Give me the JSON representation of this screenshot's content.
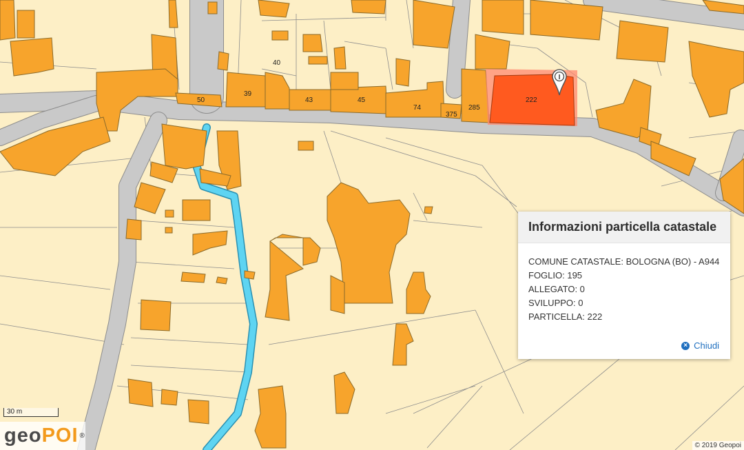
{
  "map": {
    "parcel_labels": [
      "40",
      "50",
      "39",
      "43",
      "45",
      "74",
      "375",
      "285",
      "222"
    ],
    "selected_parcel": "222",
    "marker_glyph": "I",
    "colors": {
      "background": "#fdefc6",
      "building": "#f7a42c",
      "selected": "#ff5a1f",
      "road": "#c9c9c9",
      "river": "#5ed4f2"
    }
  },
  "info_panel": {
    "title": "Informazioni particella catastale",
    "lines": [
      "COMUNE CATASTALE: BOLOGNA (BO) - A944",
      "FOGLIO: 195",
      "ALLEGATO: 0",
      "SVILUPPO: 0",
      "PARTICELLA: 222"
    ],
    "close_label": "Chiudi",
    "close_icon": "close-circle-icon"
  },
  "scale": {
    "label": "30 m"
  },
  "brand": {
    "logo_part1": "geo",
    "logo_part2": "POI",
    "logo_mark": "®"
  },
  "attribution": "© 2019 Geopoi"
}
